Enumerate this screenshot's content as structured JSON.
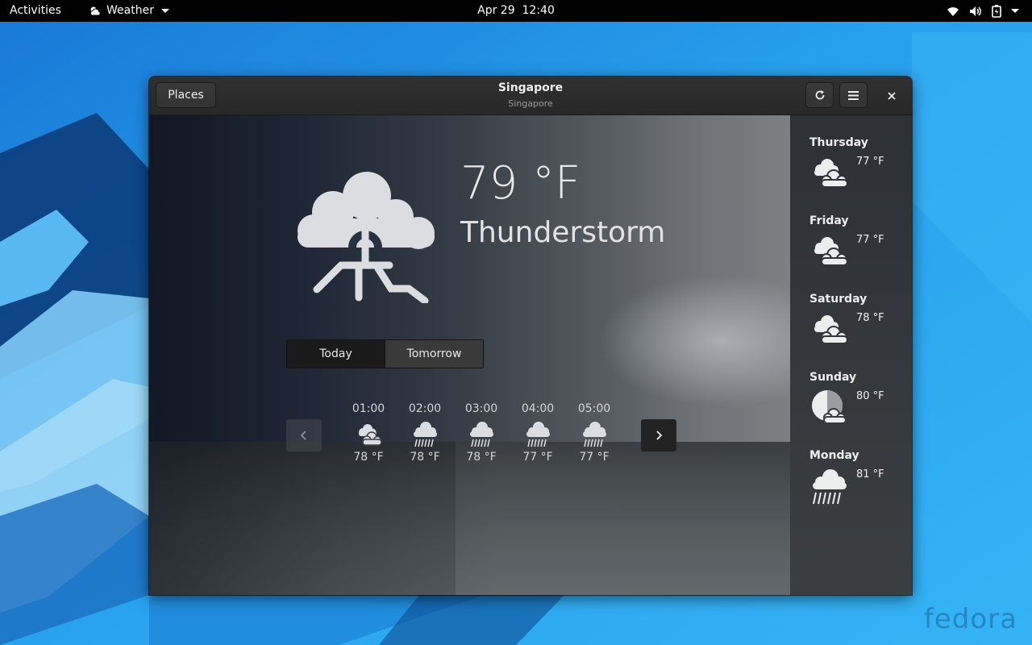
{
  "topbar": {
    "activities": "Activities",
    "app_name": "Weather",
    "clock": "Apr 29  12:40"
  },
  "desktop": {
    "watermark": "fedora"
  },
  "window": {
    "title": "Singapore",
    "subtitle": "Singapore",
    "places_button": "Places",
    "refresh_icon": "refresh-icon",
    "menu_icon": "hamburger-menu-icon",
    "close_icon": "close-icon"
  },
  "current": {
    "temperature": "79 °F",
    "condition": "Thunderstorm",
    "icon": "thunderstorm-icon"
  },
  "day_tabs": {
    "today": "Today",
    "tomorrow": "Tomorrow",
    "selected": "Today"
  },
  "hourly": [
    {
      "time": "01:00",
      "temp": "78 °F",
      "icon": "overcast-icon"
    },
    {
      "time": "02:00",
      "temp": "78 °F",
      "icon": "rain-icon"
    },
    {
      "time": "03:00",
      "temp": "78 °F",
      "icon": "rain-icon"
    },
    {
      "time": "04:00",
      "temp": "77 °F",
      "icon": "rain-icon"
    },
    {
      "time": "05:00",
      "temp": "77 °F",
      "icon": "rain-icon"
    }
  ],
  "forecast": [
    {
      "day": "Thursday",
      "temp": "77 °F",
      "icon": "overcast-icon"
    },
    {
      "day": "Friday",
      "temp": "77 °F",
      "icon": "overcast-icon"
    },
    {
      "day": "Saturday",
      "temp": "78 °F",
      "icon": "overcast-icon"
    },
    {
      "day": "Sunday",
      "temp": "80 °F",
      "icon": "few-clouds-night-icon"
    },
    {
      "day": "Monday",
      "temp": "81 °F",
      "icon": "rain-icon"
    }
  ]
}
